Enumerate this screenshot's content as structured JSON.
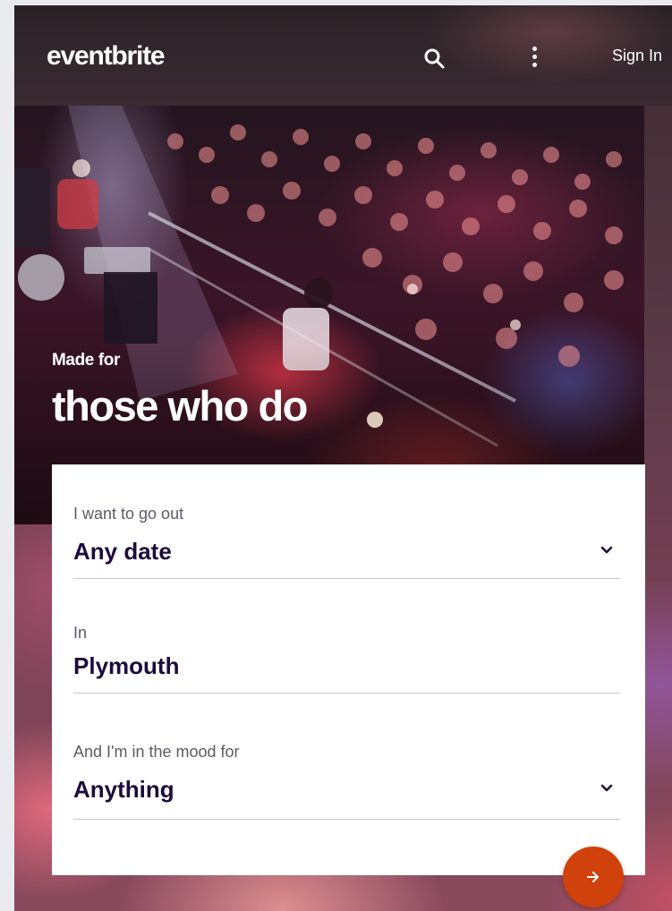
{
  "header": {
    "logo": "eventbrite",
    "search_icon": "search-icon",
    "more_icon": "more-vertical-icon",
    "sign_in": "Sign In"
  },
  "hero": {
    "kicker": "Made for",
    "title": "those who do"
  },
  "search_form": {
    "date": {
      "label": "I want to go out",
      "value": "Any date",
      "icon": "chevron-down-icon"
    },
    "location": {
      "label": "In",
      "value": "Plymouth"
    },
    "mood": {
      "label": "And I'm in the mood for",
      "value": "Anything",
      "icon": "chevron-down-icon"
    },
    "submit_icon": "arrow-right-icon"
  },
  "colors": {
    "brand_orange": "#d1410c",
    "heading_purple": "#1e0a3c",
    "label_gray": "#5e5a66"
  }
}
